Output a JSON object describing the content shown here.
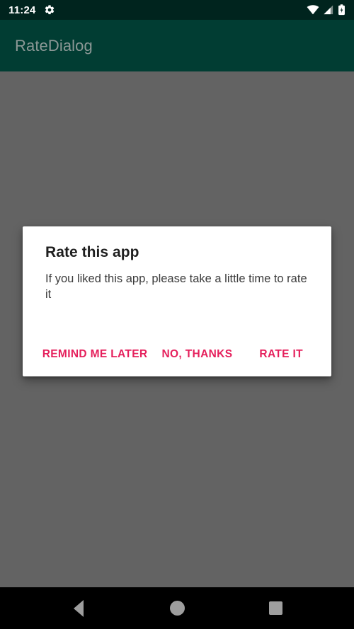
{
  "status_bar": {
    "clock": "11:24",
    "icons": {
      "settings": "gear-icon",
      "wifi": "wifi-icon",
      "cellular": "cellular-signal-icon",
      "battery": "battery-charging-icon"
    },
    "background_color": "#00241E",
    "foreground_color": "#FFFFFF"
  },
  "app_bar": {
    "title": "RateDialog",
    "background_color": "#013D33",
    "title_color": "#8C9896"
  },
  "scrim": {
    "color": "#636363"
  },
  "dialog": {
    "title": "Rate this app",
    "message": "If you liked this app, please take a little time to rate it",
    "background_color": "#FFFFFF",
    "accent_color": "#E5205C",
    "buttons": [
      {
        "label": "REMIND ME LATER",
        "name": "remind-me-later-button"
      },
      {
        "label": "NO, THANKS",
        "name": "no-thanks-button"
      },
      {
        "label": "RATE IT",
        "name": "rate-it-button"
      }
    ]
  },
  "navigation_bar": {
    "background_color": "#000000",
    "icon_color": "#9E9E9E",
    "buttons": [
      {
        "label": "Back",
        "name": "nav-back-button"
      },
      {
        "label": "Home",
        "name": "nav-home-button"
      },
      {
        "label": "Recent apps",
        "name": "nav-recent-apps-button"
      }
    ]
  }
}
